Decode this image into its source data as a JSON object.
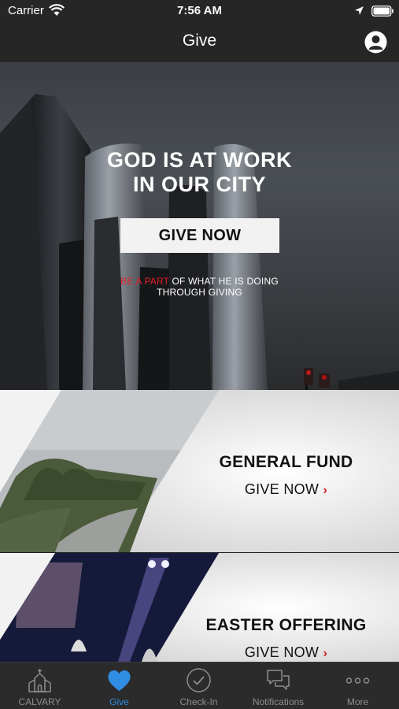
{
  "status_bar": {
    "carrier": "Carrier",
    "time": "7:56 AM"
  },
  "nav": {
    "title": "Give",
    "profile_icon": "profile-icon"
  },
  "hero": {
    "headline_line1": "GOD IS AT WORK",
    "headline_line2": "IN OUR CITY",
    "button_label": "GIVE NOW",
    "sub_line1_accent": "BE A PART",
    "sub_line1_rest": " OF WHAT HE IS DOING",
    "sub_line2": "THROUGH GIVING",
    "accent_color": "#e0202a"
  },
  "funds": [
    {
      "title": "GENERAL FUND",
      "give_label": "GIVE NOW",
      "chevron": "›"
    },
    {
      "title": "EASTER OFFERING",
      "give_label": "GIVE NOW",
      "chevron": "›"
    }
  ],
  "tabs": [
    {
      "label": "CALVARY",
      "icon": "church-icon",
      "active": false
    },
    {
      "label": "Give",
      "icon": "heart-icon",
      "active": true
    },
    {
      "label": "Check-In",
      "icon": "checkmark-circle-icon",
      "active": false
    },
    {
      "label": "Notifications",
      "icon": "chat-bubbles-icon",
      "active": false
    },
    {
      "label": "More",
      "icon": "more-dots-icon",
      "active": false
    }
  ],
  "colors": {
    "tab_active": "#2f8de4",
    "tab_inactive": "#8e8e8e",
    "chevron": "#d01f26"
  }
}
